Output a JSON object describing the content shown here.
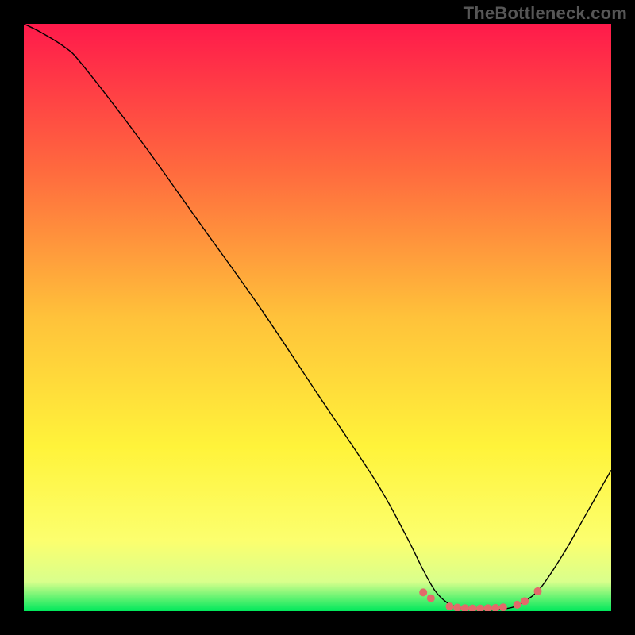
{
  "attribution": "TheBottleneck.com",
  "chart_data": {
    "type": "line",
    "title": "",
    "xlabel": "",
    "ylabel": "",
    "xlim": [
      0,
      100
    ],
    "ylim": [
      0,
      100
    ],
    "background_gradient": {
      "stops": [
        {
          "offset": 0.0,
          "color": "#ff1a4b"
        },
        {
          "offset": 0.25,
          "color": "#ff6a3e"
        },
        {
          "offset": 0.5,
          "color": "#ffc23a"
        },
        {
          "offset": 0.72,
          "color": "#fff33a"
        },
        {
          "offset": 0.88,
          "color": "#fcff6e"
        },
        {
          "offset": 0.95,
          "color": "#d9ff8c"
        },
        {
          "offset": 1.0,
          "color": "#00e85c"
        }
      ]
    },
    "series": [
      {
        "name": "curve",
        "color": "#000000",
        "width": 1.4,
        "points": [
          {
            "x": 0.0,
            "y": 100.0
          },
          {
            "x": 3.0,
            "y": 98.5
          },
          {
            "x": 7.0,
            "y": 96.0
          },
          {
            "x": 10.0,
            "y": 93.0
          },
          {
            "x": 20.0,
            "y": 80.0
          },
          {
            "x": 30.0,
            "y": 66.0
          },
          {
            "x": 40.0,
            "y": 52.0
          },
          {
            "x": 50.0,
            "y": 37.0
          },
          {
            "x": 60.0,
            "y": 22.0
          },
          {
            "x": 65.0,
            "y": 13.0
          },
          {
            "x": 68.0,
            "y": 7.0
          },
          {
            "x": 70.0,
            "y": 3.5
          },
          {
            "x": 72.0,
            "y": 1.5
          },
          {
            "x": 74.0,
            "y": 0.6
          },
          {
            "x": 77.0,
            "y": 0.2
          },
          {
            "x": 80.0,
            "y": 0.2
          },
          {
            "x": 83.0,
            "y": 0.6
          },
          {
            "x": 85.0,
            "y": 1.5
          },
          {
            "x": 88.0,
            "y": 4.0
          },
          {
            "x": 92.0,
            "y": 10.0
          },
          {
            "x": 96.0,
            "y": 17.0
          },
          {
            "x": 100.0,
            "y": 24.0
          }
        ]
      }
    ],
    "markers": {
      "name": "bottom-dots",
      "color": "#e26a6a",
      "radius": 5,
      "points": [
        {
          "x": 68.0,
          "y": 3.2
        },
        {
          "x": 69.3,
          "y": 2.2
        },
        {
          "x": 72.5,
          "y": 0.8
        },
        {
          "x": 73.8,
          "y": 0.6
        },
        {
          "x": 75.1,
          "y": 0.5
        },
        {
          "x": 76.4,
          "y": 0.45
        },
        {
          "x": 77.7,
          "y": 0.45
        },
        {
          "x": 79.0,
          "y": 0.5
        },
        {
          "x": 80.3,
          "y": 0.55
        },
        {
          "x": 81.6,
          "y": 0.65
        },
        {
          "x": 84.0,
          "y": 1.1
        },
        {
          "x": 85.3,
          "y": 1.7
        },
        {
          "x": 87.5,
          "y": 3.4
        }
      ]
    }
  }
}
